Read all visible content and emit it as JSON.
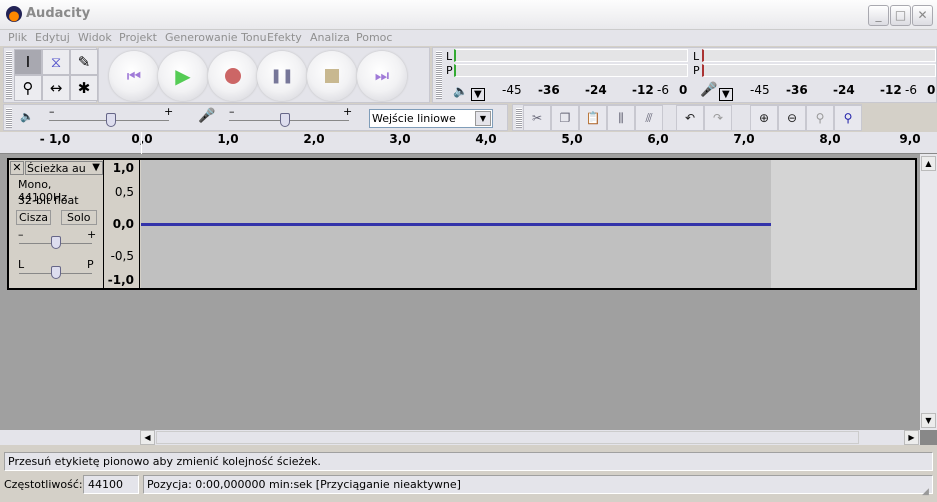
{
  "window": {
    "title": "Audacity",
    "minimize": "_",
    "maximize": "□",
    "close": "✕"
  },
  "menu": [
    "Plik",
    "Edytuj",
    "Widok",
    "Projekt",
    "Generowanie Tonu",
    "Efekty",
    "Analiza",
    "Pomoc"
  ],
  "meters": {
    "play": {
      "left": "L",
      "right": "P"
    },
    "record": {
      "left": "L",
      "right": "P"
    },
    "scale": [
      "-45",
      "-36",
      "-24",
      "-12",
      "-6",
      "0"
    ]
  },
  "mixer": {
    "minus": "–",
    "plus": "+",
    "input_source": "Wejście liniowe"
  },
  "ruler": {
    "labels": [
      "- 1,0",
      "0,0",
      "1,0",
      "2,0",
      "3,0",
      "4,0",
      "5,0",
      "6,0",
      "7,0",
      "8,0",
      "9,0"
    ]
  },
  "track": {
    "name": "Ścieżka au",
    "format": "Mono, 44100Hz",
    "bitdepth": "32-bit float",
    "mute": "Cisza",
    "solo": "Solo",
    "gain_minus": "–",
    "gain_plus": "+",
    "pan_left": "L",
    "pan_right": "P",
    "gain": 0.5,
    "pan": 0.5,
    "close": "✕",
    "vruler": [
      "1,0",
      "0,5",
      "0,0",
      "-0,5",
      "-1,0"
    ],
    "waveform_color": "#3333aa"
  },
  "status": {
    "message": "Przesuń etykietę pionowo aby zmienić kolejność ścieżek.",
    "rate_label": "Częstotliwość:",
    "rate": "44100",
    "position": "Pozycja: 0:00,000000 min:sek   [Przyciąganie nieaktywne]"
  }
}
